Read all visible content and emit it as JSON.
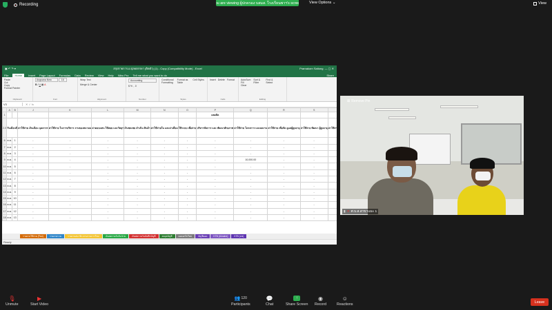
{
  "topbar": {
    "recording_label": "Recording",
    "viewing_banner": "You are viewing ผู้ปกครอง บสมส. โรงเรียนพาฯ's screen",
    "view_options_label": "View Options",
    "view_label": "View"
  },
  "excel": {
    "title": "สรุปรายการ-ผ.ปุลยตรรษา (ติดตัว) (1) - Copy (Compatibility Mode) - Excel",
    "user": "Pramakorn Saitong",
    "tabs": [
      "File",
      "Home",
      "Insert",
      "Page Layout",
      "Formulas",
      "Data",
      "Review",
      "View",
      "Help",
      "Nitro Pro",
      "Tell me what you want to do"
    ],
    "share_label": "Share",
    "ribbon": {
      "paste": "Paste",
      "cut": "Cut",
      "copy": "Copy",
      "format_painter": "Format Painter",
      "font_name": "Angsana New",
      "font_size": "16",
      "wrap_text": "Wrap Text",
      "merge_center": "Merge & Center",
      "number_format": "Accounting",
      "conditional": "Conditional Formatting",
      "format_table": "Format as Table",
      "cell_styles": "Cell Styles",
      "insert": "Insert",
      "delete": "Delete",
      "format": "Format",
      "autosum": "AutoSum",
      "fill": "Fill",
      "clear": "Clear",
      "sort_filter": "Sort & Filter",
      "find_select": "Find & Select",
      "groups": [
        "Clipboard",
        "Font",
        "Alignment",
        "Number",
        "Styles",
        "Cells",
        "Editing"
      ]
    },
    "namebox": "V3",
    "columns": [
      "A",
      "B",
      "J",
      "K",
      "L",
      "M",
      "N",
      "O",
      "P",
      "Q",
      "R",
      "S",
      "T",
      "U",
      "V",
      "W",
      "X",
      "Y",
      "Z",
      "AA"
    ],
    "header_row1_label": "ผลผลิต",
    "header_row1_account": "บัญชีเงินฝาก",
    "column_headers": [
      "วันเดือนปี",
      "ค่าใช้จ่าย เงินเดือน บุคลากร",
      "ค่าใช้จ่าย ในการบริหาร งานของสมาคม",
      "ค่าตอบแทน ใช้สอย และวัสดุฯ",
      "เงินชดเชย ดำเนิน สินค้า",
      "ค่าใช้จ่ายใน และค่าเสื่อม",
      "ใช้ระบบ เพื่อจ่าย",
      "บริหารจัดการ และ พัฒนาศักยภาพ",
      "ค่าใช้จ่าย โครงการ และผลงาน",
      "ค่าใช้จ่าย เพื่อจัด ดูแลผู้สูงอายุ",
      "ค่าใช้จ่าย พัฒนา ผู้สูงอายุ",
      "ค่าใช้จ่าย ส่งเสริม สุขภาพ",
      "",
      "ดอกเบี้ย เงินฝาก ธนาคาร",
      "ยืมเงิน",
      "ยืมบัญชี",
      "รับคืน",
      "จำนวนเงิน"
    ],
    "rows": [
      {
        "row": "6",
        "date": "ต.ค.",
        "n": "1"
      },
      {
        "row": "7",
        "date": "ต.ค.",
        "n": "2"
      },
      {
        "row": "8",
        "date": "ต.ค.",
        "n": "3"
      },
      {
        "row": "9",
        "date": "ต.ค.",
        "n": "4",
        "q": "10,000.00"
      },
      {
        "row": "10",
        "date": "ต.ค.",
        "n": "5"
      },
      {
        "row": "11",
        "date": "ต.ค.",
        "n": "6"
      },
      {
        "row": "12",
        "date": "ต.ค.",
        "n": "7"
      },
      {
        "row": "13",
        "date": "ต.ค.",
        "n": "8"
      },
      {
        "row": "14",
        "date": "ต.ค.",
        "n": "9"
      },
      {
        "row": "15",
        "date": "ต.ค.",
        "n": "10"
      },
      {
        "row": "16",
        "date": "ต.ค.",
        "n": "11"
      },
      {
        "row": "17",
        "date": "ต.ค.",
        "n": "12"
      },
      {
        "row": "18",
        "date": "ต.ค.",
        "n": "13"
      }
    ],
    "sheet_tabs": [
      {
        "label": "รายงานใช้จ่าย (ใหม่)",
        "color": "#d46b08"
      },
      {
        "label": "รายงานรวม",
        "color": "#2f86c9"
      },
      {
        "label": "รายงานสมาชิก ตามรายการใหม่",
        "color": "#f4c430"
      },
      {
        "label": "เงินสดรายวันรับ/จ่าย",
        "color": "#27a844"
      },
      {
        "label": "เงินสดรายวันบันทึกบัญชี",
        "color": "#d32f2f"
      },
      {
        "label": "งบดุลบัญชี",
        "color": "#2e7d32"
      },
      {
        "label": "ยอดยกไปใหม่",
        "color": "#7b7b7b"
      },
      {
        "label": "บัญชียอด",
        "color": "#6a3fb5"
      },
      {
        "label": "KTB (Ukraine)",
        "color": "#7e57c2"
      },
      {
        "label": "KTB (นช)",
        "color": "#5e35b1"
      }
    ],
    "status": "Ready"
  },
  "video": {
    "remove_pin": "Remove Pin",
    "participant_name": "ศ.บ.ส.สาขาแมะ 1"
  },
  "bottombar": {
    "unmute": "Unmute",
    "start_video": "Start Video",
    "participants": "Participants",
    "participants_count": "120",
    "chat": "Chat",
    "share_screen": "Share Screen",
    "record": "Record",
    "reactions": "Reactions",
    "leave": "Leave"
  },
  "colors": {
    "excel_green": "#217346",
    "zoom_green": "#2eae4f",
    "leave_red": "#d6311e"
  }
}
